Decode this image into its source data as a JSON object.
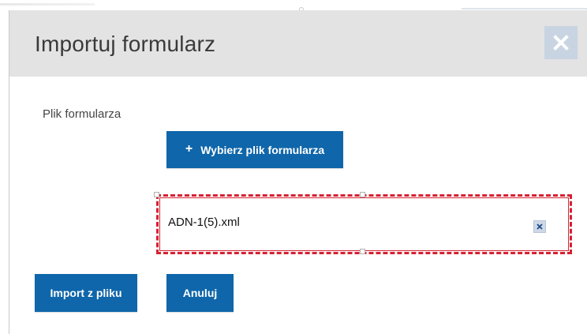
{
  "dialog": {
    "title": "Importuj formularz",
    "close_icon": "close-icon"
  },
  "form": {
    "file_label": "Plik formularza",
    "choose_button_label": "Wybierz plik formularza",
    "choose_button_icon": "plus-icon",
    "selected_file": {
      "name": "ADN-1(5).xml",
      "remove_icon": "remove-icon"
    }
  },
  "actions": {
    "import_label": "Import z pliku",
    "cancel_label": "Anuluj"
  },
  "colors": {
    "primary": "#0f66aa",
    "header_bg": "#e3e3e3",
    "close_bg": "#c9d4e2",
    "highlight": "#d42232"
  }
}
